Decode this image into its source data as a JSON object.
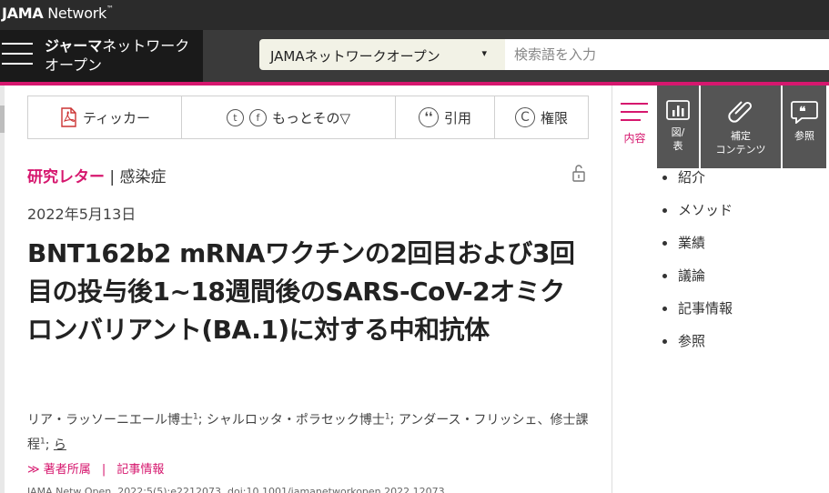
{
  "topbar": {
    "brand_bold": "JAMA",
    "brand_rest": " Network"
  },
  "header": {
    "logo_bold": "ジャーマ",
    "logo_rest": "ネットワーク",
    "logo_line2": "オープン",
    "select_value": "JAMAネットワークオープン",
    "select_caret": "▾",
    "search_placeholder": "検索語を入力"
  },
  "toolbar": {
    "ticker": "ティッカー",
    "share_twitter": "t",
    "share_facebook": "f",
    "more": "もっとその▽",
    "cite_icon": "❛❛",
    "cite": "引用",
    "permissions_icon": "C",
    "permissions": "権限"
  },
  "article": {
    "type": "研究レター",
    "sep": " | ",
    "category": "感染症",
    "date": "2022年5月13日",
    "title": "BNT162b2 mRNAワクチンの2回目および3回目の投与後1~18週間後のSARS-CoV-2オミクロンバリアント(BA.1)に対する中和抗体",
    "authors": [
      {
        "name": "リア・ラッソーニエール博士",
        "sup": "1",
        "after": "; "
      },
      {
        "name": "シャルロッタ・ポラセック博士",
        "sup": "1",
        "after": "; "
      },
      {
        "name": "アンダース・フリッシェ、修士課程",
        "sup": "1",
        "after": "; "
      }
    ],
    "et_al": "ら",
    "affiliations": "≫ 著者所属",
    "link_sep": "|",
    "article_info": "記事情報",
    "citation_cut": "JAMA Netw Open. 2022;5(5):e2212073. doi:10.1001/jamanetworkopen.2022.12073"
  },
  "sidebar": {
    "toc_label": "内容",
    "tabs": {
      "figures": [
        "図/",
        "表"
      ],
      "supplemental": [
        "補定",
        "コンテンツ"
      ],
      "references": "参照"
    },
    "toc_items": [
      "紹介",
      "メソッド",
      "業績",
      "議論",
      "記事情報",
      "参照"
    ]
  },
  "colors": {
    "accent": "#d6176e",
    "header_bg": "#3a3a3a",
    "tab_bg": "#555555"
  }
}
